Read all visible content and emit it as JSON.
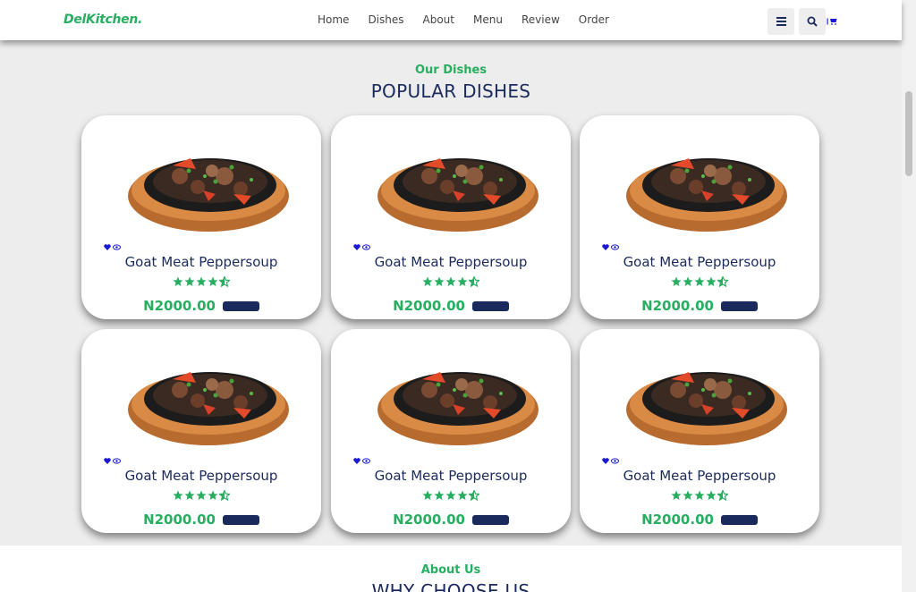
{
  "brand": {
    "logo": "DelKitchen."
  },
  "nav": {
    "items": [
      "Home",
      "Dishes",
      "About",
      "Menu",
      "Review",
      "Order"
    ]
  },
  "header": {
    "menu_icon": "bars-icon",
    "search_icon": "search-icon",
    "cart_icon": "cart-icon"
  },
  "section": {
    "subtitle": "Our Dishes",
    "title": "POPULAR DISHES"
  },
  "dishes": [
    {
      "name": "Goat Meat Peppersoup",
      "price": "N2000.00",
      "rating": 4.5
    },
    {
      "name": "Goat Meat Peppersoup",
      "price": "N2000.00",
      "rating": 4.5
    },
    {
      "name": "Goat Meat Peppersoup",
      "price": "N2000.00",
      "rating": 4.5
    },
    {
      "name": "Goat Meat Peppersoup",
      "price": "N2000.00",
      "rating": 4.5
    },
    {
      "name": "Goat Meat Peppersoup",
      "price": "N2000.00",
      "rating": 4.5
    },
    {
      "name": "Goat Meat Peppersoup",
      "price": "N2000.00",
      "rating": 4.5
    }
  ],
  "about": {
    "subtitle": "About Us",
    "title": "WHY CHOOSE US"
  },
  "colors": {
    "accent": "#27ae60",
    "navy": "#1b2a5c",
    "icon_blue": "#1a1ad6"
  }
}
